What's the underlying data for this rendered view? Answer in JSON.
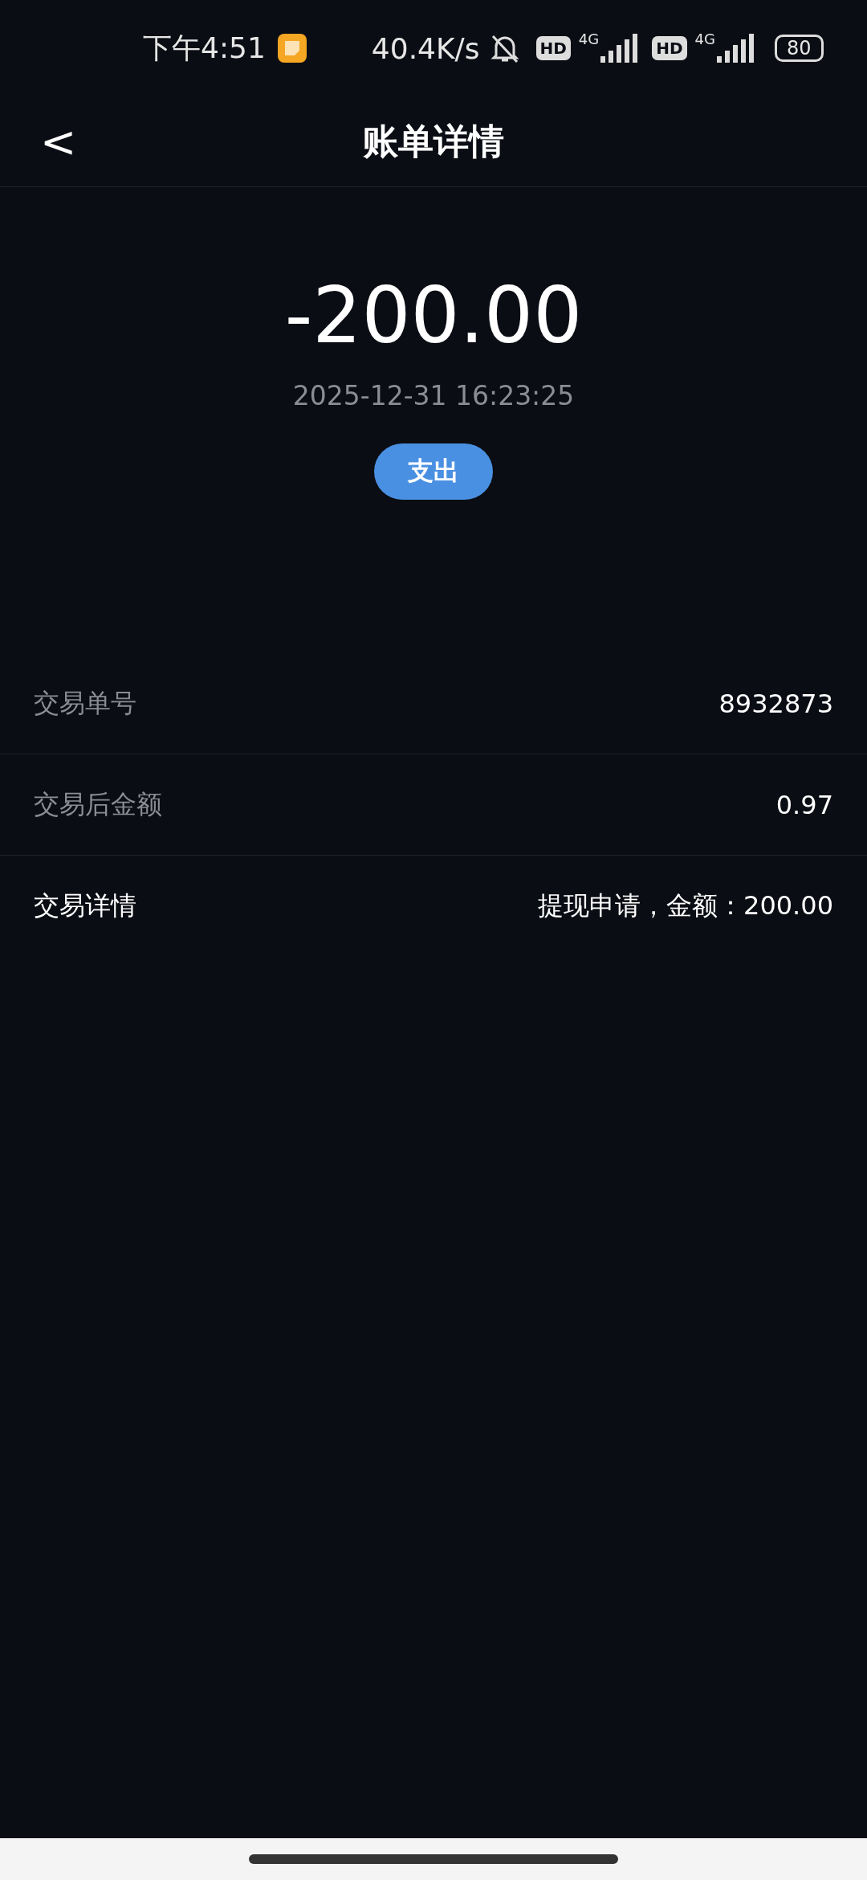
{
  "status_bar": {
    "time": "下午4:51",
    "net_speed": "40.4K/s",
    "sims": [
      {
        "hd": "HD",
        "network": "4G"
      },
      {
        "hd": "HD",
        "network": "4G"
      }
    ],
    "battery": "80"
  },
  "header": {
    "back": "<",
    "title": "账单详情"
  },
  "summary": {
    "amount": "-200.00",
    "datetime": "2025-12-31 16:23:25",
    "tag": "支出"
  },
  "rows": [
    {
      "label": "交易单号",
      "value": "8932873",
      "highlight": false
    },
    {
      "label": "交易后金额",
      "value": "0.97",
      "highlight": false
    },
    {
      "label": "交易详情",
      "value": "提现申请，金额：200.00",
      "highlight": true
    }
  ]
}
